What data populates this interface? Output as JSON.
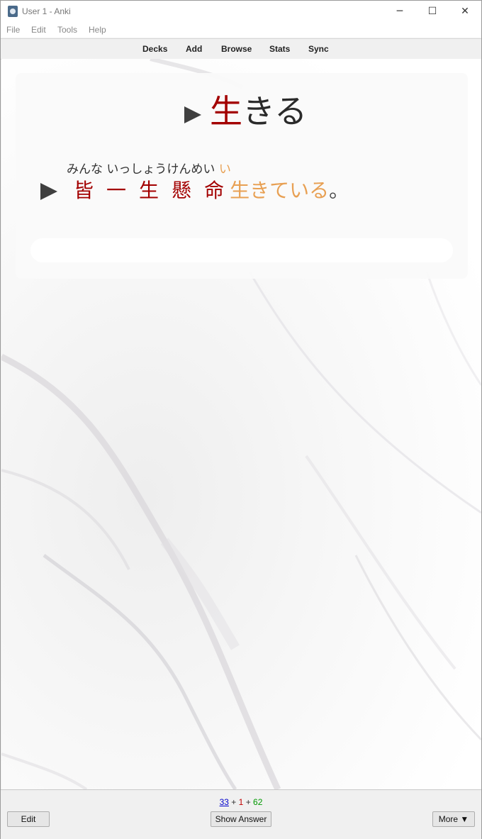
{
  "window": {
    "title": "User 1 - Anki",
    "controls": {
      "minimize": "─",
      "maximize": "☐",
      "close": "✕"
    }
  },
  "menu": [
    "File",
    "Edit",
    "Tools",
    "Help"
  ],
  "toolbar": [
    "Decks",
    "Add",
    "Browse",
    "Stats",
    "Sync"
  ],
  "card": {
    "word_kanji": "生",
    "word_kana": "きる",
    "furigana_main": "みんな いっしょうけんめい ",
    "furigana_accent": "い",
    "sentence": {
      "kanji": [
        "皆",
        "一",
        "生",
        "懸",
        "命"
      ],
      "kanji_okurigana": "生きている",
      "end": "。"
    },
    "answer_input_value": ""
  },
  "counts": {
    "new": "33",
    "learning": "1",
    "review": "62",
    "sep": "+"
  },
  "buttons": {
    "edit": "Edit",
    "show_answer": "Show Answer",
    "more": "More ▼"
  },
  "colors": {
    "kanji": "#a30000",
    "accent_orange": "#e8a053",
    "new_count": "#0000cc",
    "learn_count": "#c00000",
    "review_count": "#009900"
  },
  "icons": [
    "anki-app-icon",
    "play-audio-icon"
  ]
}
